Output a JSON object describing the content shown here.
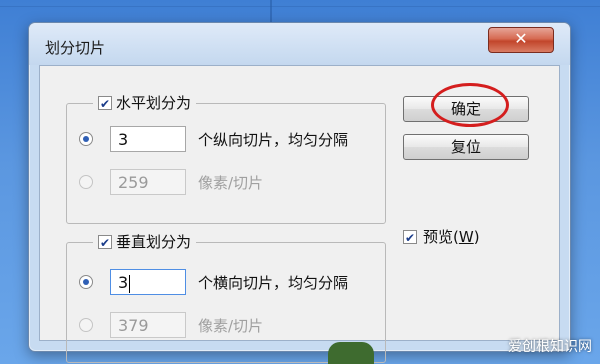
{
  "dialog": {
    "title": "划分切片",
    "close_label": "✕"
  },
  "horizontal_group": {
    "checkbox_label": "水平划分为",
    "checked": true,
    "option_count": {
      "value": "3",
      "desc": "个纵向切片，均匀分隔"
    },
    "option_pixels": {
      "value": "259",
      "desc": "像素/切片"
    }
  },
  "vertical_group": {
    "checkbox_label": "垂直划分为",
    "checked": true,
    "option_count": {
      "value": "3",
      "desc": "个横向切片，均匀分隔"
    },
    "option_pixels": {
      "value": "379",
      "desc": "像素/切片"
    }
  },
  "buttons": {
    "ok_label": "确定",
    "reset_label": "复位"
  },
  "preview": {
    "label": "预览",
    "shortcut": "W",
    "checked": true
  },
  "watermark": "爱创根知识网",
  "colors": {
    "highlight_ring": "#d41e1e",
    "radio_selected": "#2f5fb5"
  }
}
